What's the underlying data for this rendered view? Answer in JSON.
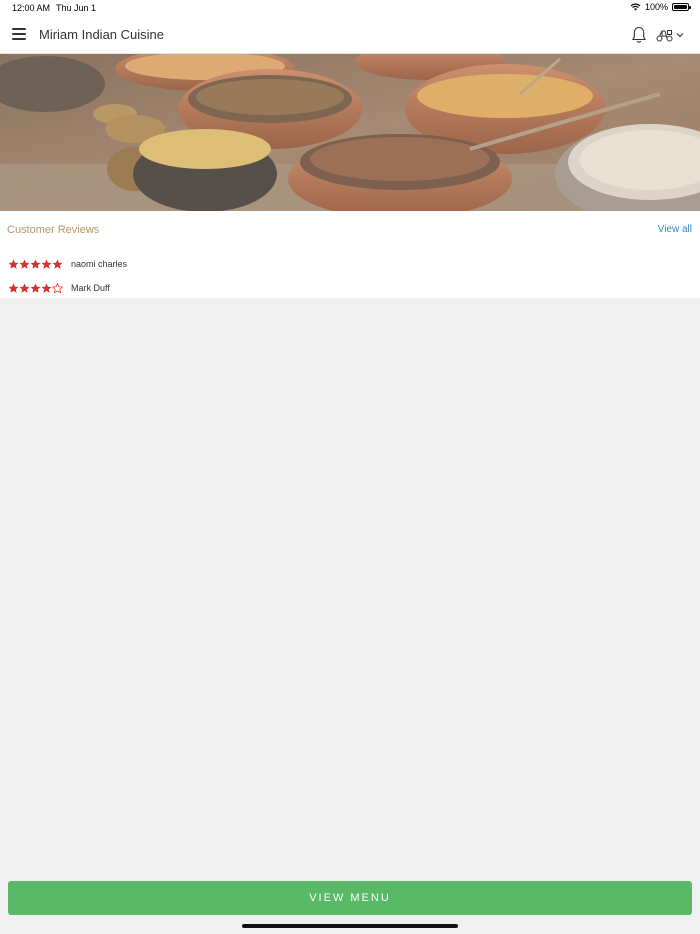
{
  "status_bar": {
    "time": "12:00 AM",
    "date": "Thu Jun 1",
    "battery": "100%",
    "icons": [
      "wifi-icon",
      "battery-icon"
    ]
  },
  "header": {
    "title": "Miriam Indian Cuisine",
    "icons": [
      "menu-icon",
      "bell-icon",
      "scooter-icon",
      "chevron-down-icon"
    ]
  },
  "reviews": {
    "title": "Customer Reviews",
    "view_all": "View all",
    "items": [
      {
        "name": "naomi charles",
        "rating": 5,
        "max": 5
      },
      {
        "name": "Mark Duff",
        "rating": 4,
        "max": 5
      }
    ]
  },
  "footer": {
    "view_menu": "VIEW MENU"
  },
  "colors": {
    "accent_green": "#59b967",
    "star_red": "#d9312b",
    "link_blue": "#2b8bc2",
    "section_title": "#b5966a"
  }
}
